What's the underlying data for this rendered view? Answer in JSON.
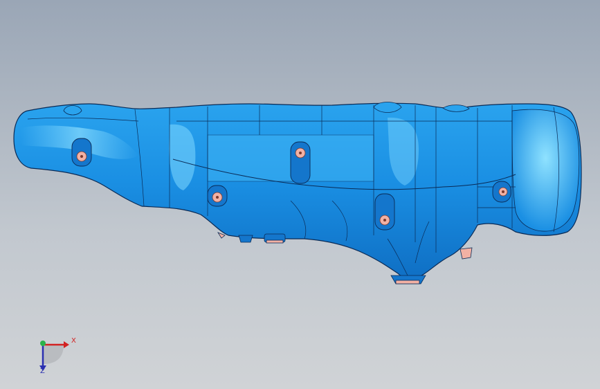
{
  "viewport": {
    "background_top": "#9aa6b6",
    "background_bottom": "#d0d3d6"
  },
  "model": {
    "body_color": "#1a8fe3",
    "highlight_color": "#5cc8ff",
    "edge_color": "#0a2a55",
    "hole_color": "#f2b1a4"
  },
  "triad": {
    "x_label": "X",
    "z_label": "Z",
    "x_color": "#d22222",
    "y_color": "#2bb34a",
    "z_color": "#2a2fb0"
  }
}
